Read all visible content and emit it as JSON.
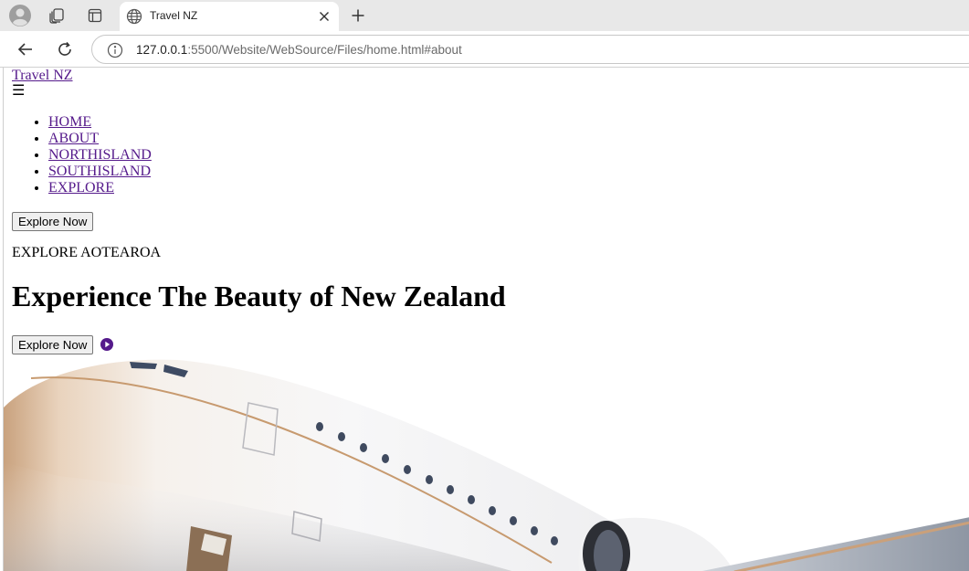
{
  "browser": {
    "tab_title": "Travel NZ",
    "url_host": "127.0.0.1",
    "url_rest": ":5500/Website/WebSource/Files/home.html#about"
  },
  "site": {
    "logo": "Travel NZ",
    "menu_toggle": "☰",
    "nav": [
      "HOME",
      "ABOUT",
      "NORTHISLAND",
      "SOUTHISLAND",
      "EXPLORE"
    ],
    "nav_button": "Explore Now",
    "eyebrow": "EXPLORE AOTEAROA",
    "hero_title": "Experience The Beauty of New Zealand",
    "hero_button": "Explore Now"
  },
  "colors": {
    "link": "#551a8b",
    "tabbar": "#e8e8e8"
  },
  "icons": {
    "profile": "profile-icon",
    "collections": "collections-icon",
    "vertical_tabs": "vertical-tabs-icon",
    "favicon": "globe-icon",
    "close": "close-icon",
    "new_tab": "plus-icon",
    "back": "back-arrow-icon",
    "refresh": "refresh-icon",
    "site_info": "info-icon",
    "play": "play-circle-icon"
  }
}
